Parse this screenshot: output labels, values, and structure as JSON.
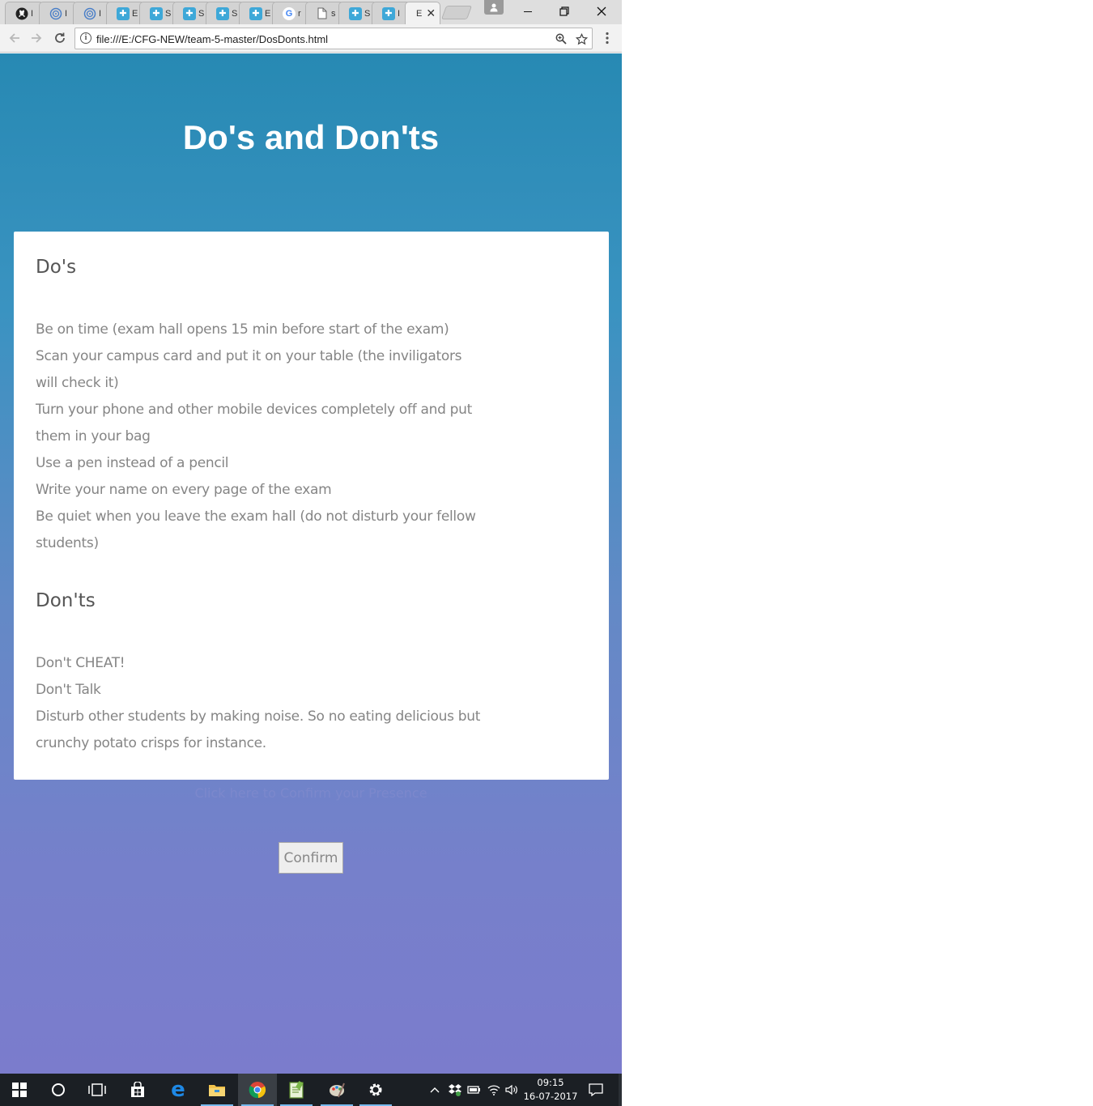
{
  "browser": {
    "tabs": [
      {
        "icon": "github-icon",
        "char": "I"
      },
      {
        "icon": "globe-icon",
        "char": "I"
      },
      {
        "icon": "globe-icon",
        "char": "I"
      },
      {
        "icon": "puzzle-icon",
        "char": "E"
      },
      {
        "icon": "puzzle-icon",
        "char": "S"
      },
      {
        "icon": "puzzle-icon",
        "char": "S"
      },
      {
        "icon": "puzzle-icon",
        "char": "S"
      },
      {
        "icon": "puzzle-icon",
        "char": "E"
      },
      {
        "icon": "google-icon",
        "char": "r"
      },
      {
        "icon": "page-icon",
        "char": "s"
      },
      {
        "icon": "puzzle-icon",
        "char": "S"
      },
      {
        "icon": "puzzle-icon",
        "char": "I"
      },
      {
        "icon": "none",
        "char": "E"
      }
    ],
    "active_tab_close": "✕",
    "address": "file:///E:/CFG-NEW/team-5-master/DosDonts.html"
  },
  "page": {
    "title": "Do's and Don'ts",
    "dos_heading": "Do's",
    "dos_lines": [
      "Be on time (exam hall opens 15 min before start of the exam)",
      "Scan your campus card and put it on your table (the inviligators",
      "will check it)",
      "Turn your phone and other mobile devices completely off and put",
      "them in your bag",
      "Use a pen instead of a pencil",
      "Write your name on every page of the exam",
      "Be quiet when you leave the exam hall (do not disturb your fellow",
      "students)"
    ],
    "donts_heading": "Don'ts",
    "donts_lines": [
      "Don't CHEAT!",
      "Don't Talk",
      "Disturb other students by making noise. So no eating delicious but",
      "crunchy potato crisps for instance."
    ],
    "confirm_prompt": "Click here to Confirm your Presence",
    "confirm_button": "Confirm"
  },
  "taskbar": {
    "time": "09:15",
    "date": "16-07-2017"
  },
  "colors": {
    "gradient_top": "#2789b3",
    "gradient_bottom": "#7b7ccc",
    "card": "#ffffff",
    "body_text": "#858585"
  }
}
